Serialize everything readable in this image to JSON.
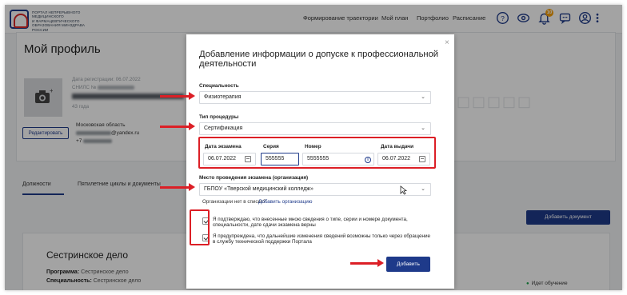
{
  "header": {
    "logo_lines": [
      "ПОРТАЛ НЕПРЕРЫВНОГО",
      "МЕДИЦИНСКОГО",
      "И ФАРМАЦЕВТИЧЕСКОГО",
      "ОБРАЗОВАНИЯ МИНЗДРАВА РОССИИ"
    ],
    "nav": [
      "Формирование траектории",
      "Мой план",
      "Портфолио",
      "Расписание"
    ],
    "notification_count": "10"
  },
  "profile": {
    "title": "Мой профиль",
    "registration": "Дата регистрации: 06.07.2022",
    "snils_label": "СНИЛС №",
    "age": "43 года",
    "region": "Московская область",
    "email_suffix": "@yandex.ru",
    "phone_prefix": "+7",
    "edit_button": "Редактировать"
  },
  "tabs": [
    "Должности",
    "Пятилетние циклы и документы"
  ],
  "add_document_button": "Добавить документ",
  "course": {
    "title": "Сестринское дело",
    "program_label": "Программа:",
    "program_value": "Сестринское дело",
    "spec_label": "Специальность:",
    "spec_value": "Сестринское дело",
    "status": "Идет обучение"
  },
  "modal": {
    "title": "Добавление информации о допуске к профессиональной деятельности",
    "close": "×",
    "specialty_label": "Специальность",
    "specialty_value": "Физиотерапия",
    "procedure_label": "Тип процедуры",
    "procedure_value": "Сертификация",
    "exam_date_label": "Дата экзамена",
    "exam_date_value": "06.07.2022",
    "series_label": "Серия",
    "series_value": "555555",
    "number_label": "Номер",
    "number_value": "5555555",
    "issue_date_label": "Дата выдачи",
    "issue_date_value": "06.07.2022",
    "place_label": "Место проведения экзамена (организация)",
    "place_value": "ГБПОУ «Тверской медицинский колледж»",
    "org_missing": "Организации нет в списке?",
    "add_org_link": "Добавить организацию",
    "confirm1": "Я подтверждаю, что внесенные мною сведения о типе, серии и номере документа, специальности, дате сдачи экзамена верны",
    "confirm2": "Я предупреждена, что дальнейшие изменения сведений возможны только через обращение в службу технической поддержки Портала",
    "submit": "Добавить"
  },
  "colors": {
    "brand": "#1e3a8a",
    "annotation": "#dc1f26",
    "status": "#16a34a"
  }
}
